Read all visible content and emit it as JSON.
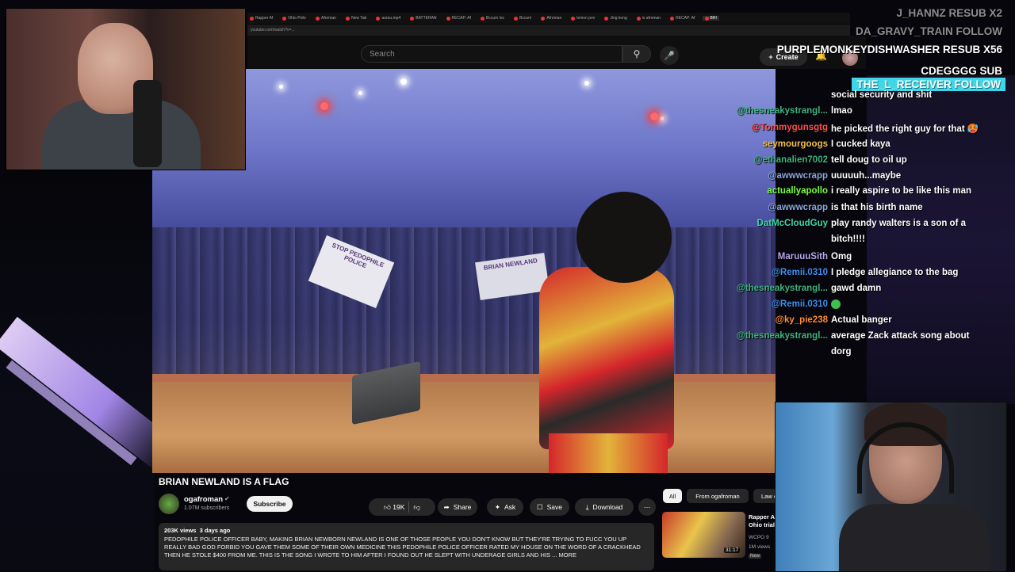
{
  "browser": {
    "tabs": [
      "Rapper Af",
      "Ohio Polic",
      "Afroman",
      "New Tab",
      "aurau.mp4",
      "BATTERAN",
      "RECAP: Af",
      "Bccum loc",
      "Bccum",
      "Afroman",
      "lemon pov",
      "Jing kong",
      "is afroman",
      "RECAP: Af",
      "BRI"
    ],
    "url": "youtube.com/watch?v=..."
  },
  "youtube": {
    "search_placeholder": "Search",
    "create_label": "Create",
    "video": {
      "title": "BRIAN NEWLAND IS A FLAG",
      "sign1": "STOP PEDOPHILE POLICE",
      "sign2": "BRIAN NEWLAND",
      "channel": "ogafroman",
      "subscribers": "1.07M subscribers",
      "subscribe_label": "Subscribe",
      "likes": "19K",
      "share_label": "Share",
      "ask_label": "Ask",
      "save_label": "Save",
      "download_label": "Download",
      "views": "203K views",
      "age": "3 days ago",
      "description": "PEDOPHILE POLICE OFFICER BABY, MAKING BRIAN NEWBORN NEWLAND IS ONE OF THOSE PEOPLE YOU DON'T KNOW BUT THEY'RE TRYING TO FUCC YOU UP REALLY BAD GOD FORBID YOU GAVE THEM SOME OF THEIR OWN MEDICINE THIS PEDOPHILE POLICE OFFICER RATED MY HOUSE ON THE WORD OF A CRACKHEAD THEN HE STOLE $400 FROM ME. THIS IS THE SONG I WROTE TO HIM AFTER I FOUND OUT HE SLEPT WITH UNDERAGE GIRLS AND HIS ... more"
    },
    "chips": [
      "All",
      "From ogafroman",
      "Law e"
    ],
    "recommendation": {
      "title": "Rapper A Ohio trial",
      "channel": "WCPO 9",
      "views": "1M views",
      "duration": "31:17",
      "badge": "New"
    }
  },
  "stream_events": [
    {
      "text": "J_HANNZ  RESUB X2",
      "faded": true
    },
    {
      "text": "DA_GRAVY_TRAIN  FOLLOW",
      "faded": true
    },
    {
      "text": "PURPLEMONKEYDISHWASHER  RESUB X56",
      "faded": false
    },
    {
      "text": "CDEGGGG  SUB",
      "faded": false
    },
    {
      "text": "THE_L_RECEIVER  FOLLOW",
      "faded": false
    }
  ],
  "chat": [
    {
      "user": "",
      "msg": "social security and shit",
      "color": "#ffffff"
    },
    {
      "user": "@thesneakystrangl...",
      "msg": "lmao",
      "color": "#3fb27f"
    },
    {
      "user": "@Tommygunsgtg",
      "msg": "he picked the right guy for that 🥵",
      "color": "#ff4f4f"
    },
    {
      "user": "seymourgoogs",
      "msg": "I cucked kaya",
      "color": "#f0c14b"
    },
    {
      "user": "@ethanalien7002",
      "msg": "tell doug to oil up",
      "color": "#3fb27f"
    },
    {
      "user": "@awwwcrapp",
      "msg": "uuuuuh...maybe",
      "color": "#8aa6d8"
    },
    {
      "user": "actuallyapollo",
      "msg": "i really aspire to be like this man",
      "color": "#7cff3f"
    },
    {
      "user": "@awwwcrapp",
      "msg": "is that his birth name",
      "color": "#8aa6d8"
    },
    {
      "user": "DatMcCloudGuy",
      "msg": "play randy walters is a son of a",
      "color": "#3fd7a6"
    },
    {
      "user": "",
      "msg": "bitch!!!!",
      "color": "#ffffff"
    },
    {
      "user": "MaruuuSith",
      "msg": "Omg",
      "color": "#b4a6e8"
    },
    {
      "user": "@Remii.0310",
      "msg": "I pledge allegiance to the bag",
      "color": "#3f8ff0"
    },
    {
      "user": "@thesneakystrangl...",
      "msg": "gawd damn",
      "color": "#3fb27f"
    },
    {
      "user": "@Remii.0310",
      "msg": "",
      "color": "#3f8ff0"
    },
    {
      "user": "@ky_pie238",
      "msg": "Actual banger",
      "color": "#ff8c2f"
    },
    {
      "user": "@thesneakystrangl...",
      "msg": "average Zack attack song about",
      "color": "#3fb27f"
    },
    {
      "user": "",
      "msg": "dorg",
      "color": "#ffffff"
    }
  ]
}
